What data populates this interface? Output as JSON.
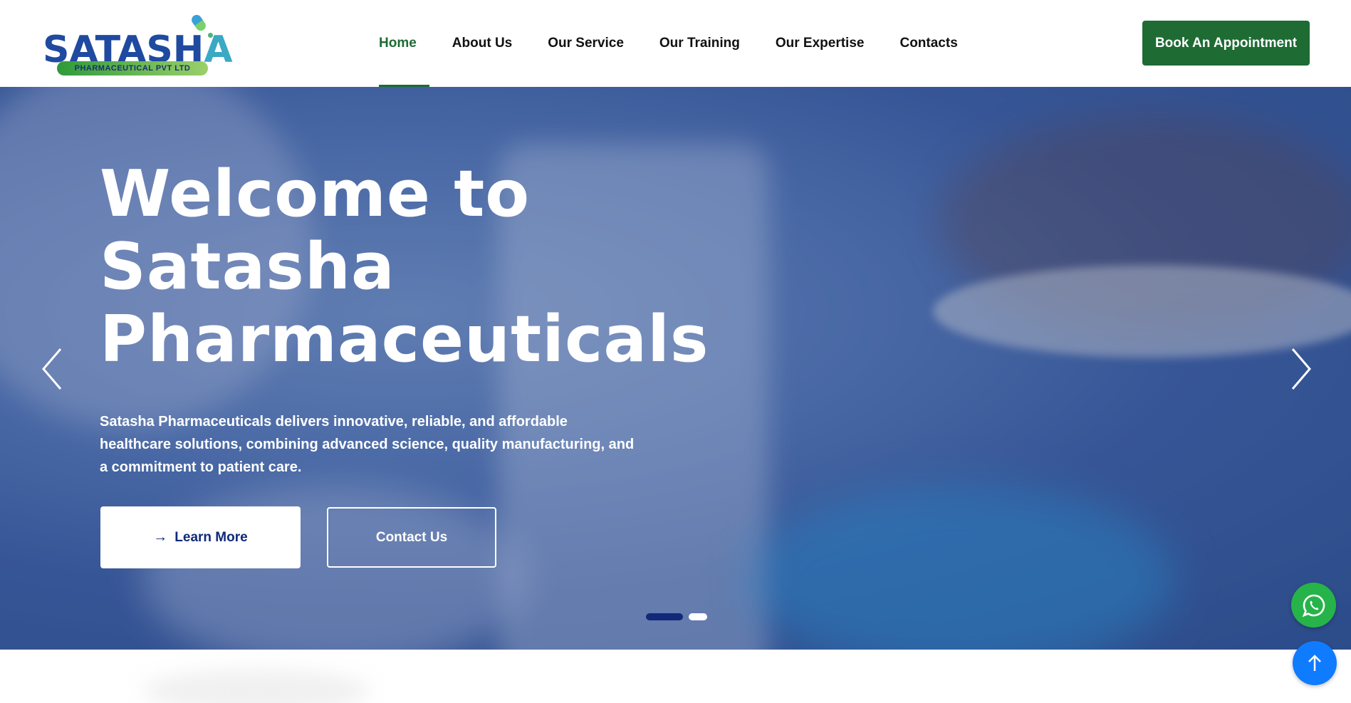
{
  "logo": {
    "word_main": "SATASH",
    "word_last": "A",
    "subtitle": "PHARMACEUTICAL PVT LTD"
  },
  "nav": {
    "items": [
      {
        "label": "Home",
        "active": true
      },
      {
        "label": "About Us",
        "active": false
      },
      {
        "label": "Our Service",
        "active": false
      },
      {
        "label": "Our Training",
        "active": false
      },
      {
        "label": "Our Expertise",
        "active": false
      },
      {
        "label": "Contacts",
        "active": false
      }
    ],
    "cta_label": "Book An Appointment"
  },
  "hero": {
    "title_line1": "Welcome to",
    "title_line2": "Satasha",
    "title_line3": "Pharmaceuticals",
    "description": "Satasha Pharmaceuticals delivers innovative, reliable, and affordable healthcare solutions, combining advanced science, quality manufacturing, and a commitment to patient care.",
    "learn_more_label": "Learn More",
    "contact_label": "Contact Us",
    "slide_count": 2,
    "active_slide": 1
  },
  "floating": {
    "whatsapp_icon": "whatsapp-icon",
    "scroll_top_icon": "arrow-up-icon"
  },
  "colors": {
    "brand_green": "#1e6b34",
    "brand_blue": "#1f4aa0",
    "whatsapp_green": "#26b34a",
    "scroll_top_blue": "#0f7bff",
    "dot_active": "#12297a"
  }
}
